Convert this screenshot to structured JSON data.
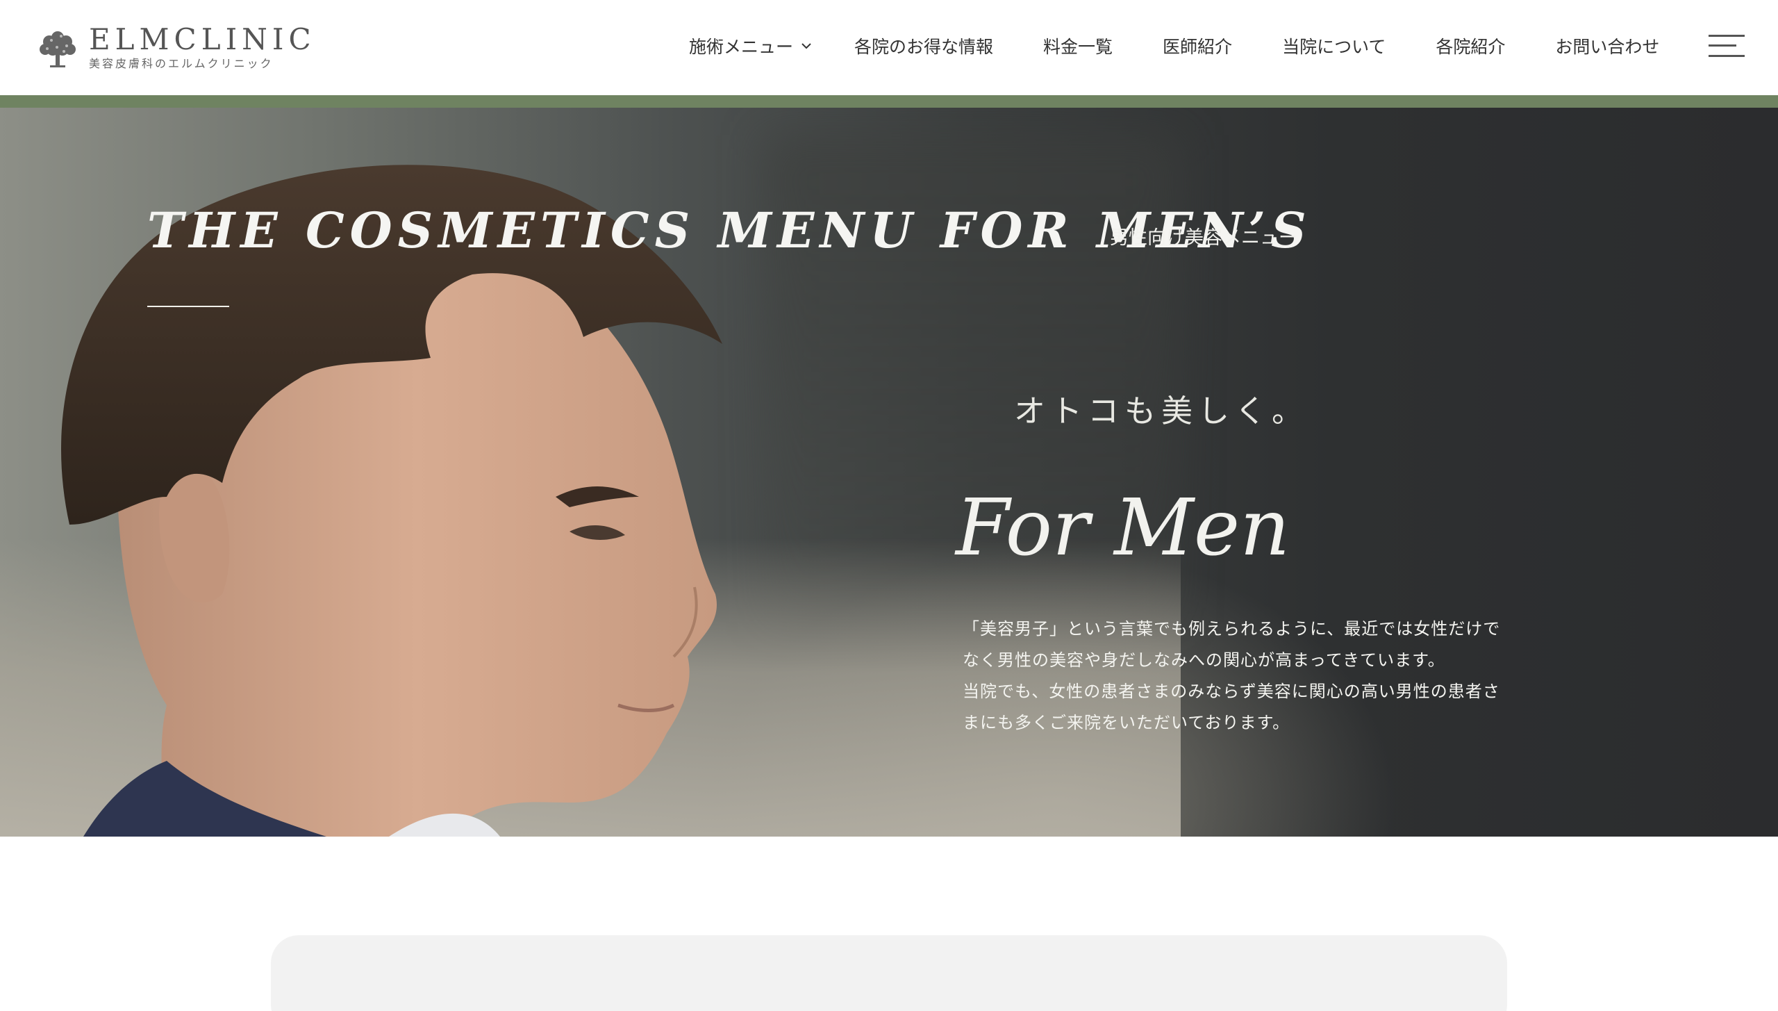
{
  "brand": {
    "name": "ELMCLINIC",
    "tagline": "美容皮膚科のエルムクリニック"
  },
  "nav": {
    "items": [
      {
        "label": "施術メニュー",
        "has_dropdown": true
      },
      {
        "label": "各院のお得な情報"
      },
      {
        "label": "料金一覧"
      },
      {
        "label": "医師紹介"
      },
      {
        "label": "当院について"
      },
      {
        "label": "各院紹介"
      },
      {
        "label": "お問い合わせ"
      }
    ],
    "menu_icon": "hamburger-menu-icon",
    "dropdown_icon": "chevron-down-icon"
  },
  "hero": {
    "title": "THE COSMETICS MENU FOR MEN’S",
    "title_ja": "男性向け美容メニュー",
    "catch": "オトコも美しく。",
    "script": "For Men",
    "description": [
      "「美容男子」という言葉でも例えられるように、最近では女性だけで",
      "なく男性の美容や身だしなみへの関心が高まってきています。",
      "当院でも、女性の患者さまのみならず美容に関心の高い男性の患者さ",
      "まにも多くご来院をいただいております。"
    ]
  },
  "colors": {
    "accent_band": "#6f8361",
    "hero_dark": "#2b2c2e",
    "card_bg": "#f2f2f2"
  }
}
